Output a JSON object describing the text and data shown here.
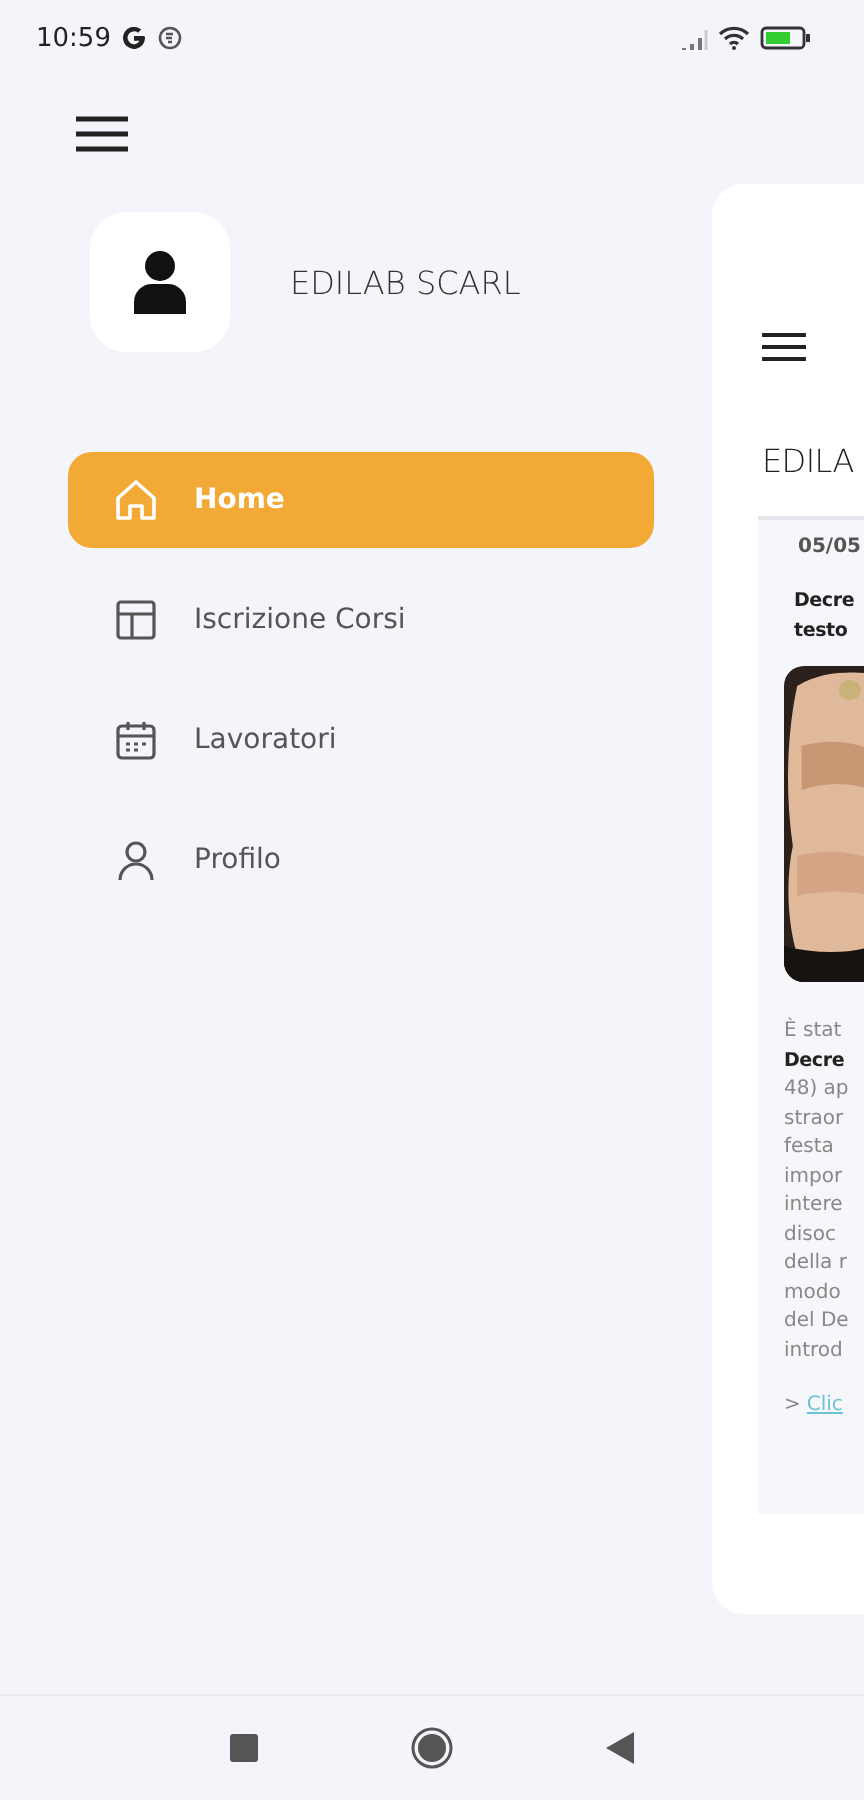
{
  "status_bar": {
    "time": "10:59"
  },
  "drawer": {
    "company": "EDILAB SCARL",
    "items": [
      {
        "label": "Home",
        "selected": true
      },
      {
        "label": "Iscrizione Corsi",
        "selected": false
      },
      {
        "label": "Lavoratori",
        "selected": false
      },
      {
        "label": "Profilo",
        "selected": false
      }
    ]
  },
  "content": {
    "title": "EDILA",
    "date": "05/05",
    "headline": [
      "Decre",
      "testo"
    ],
    "body": [
      {
        "text": "È stat",
        "bold": false
      },
      {
        "text": "Decre",
        "bold": true
      },
      {
        "text": "48) ap",
        "bold": false
      },
      {
        "text": "straor",
        "bold": false
      },
      {
        "text": "festa",
        "bold": false
      },
      {
        "text": "impor",
        "bold": false
      },
      {
        "text": "intere",
        "bold": false
      },
      {
        "text": "disoc",
        "bold": false
      },
      {
        "text": "della r",
        "bold": false
      },
      {
        "text": "modo",
        "bold": false
      },
      {
        "text": "del De",
        "bold": false
      },
      {
        "text": "introd",
        "bold": false
      }
    ],
    "link_prefix": ">",
    "link": "Clic"
  }
}
